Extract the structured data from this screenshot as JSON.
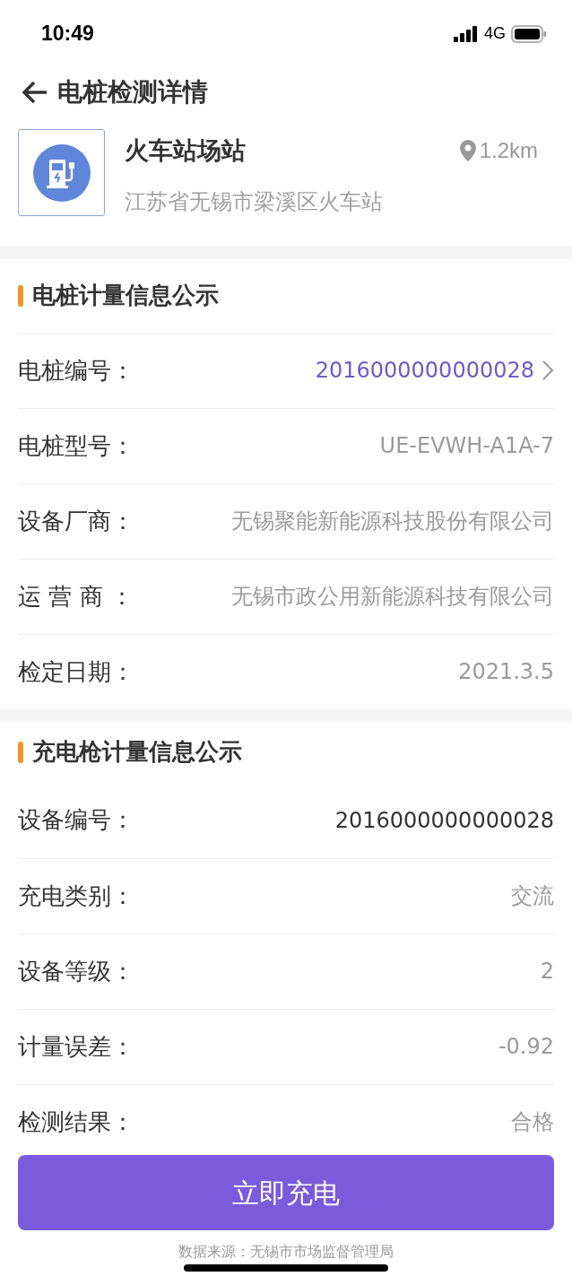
{
  "status_bar": {
    "time": "10:49",
    "network": "4G"
  },
  "header": {
    "title": "电桩检测详情"
  },
  "station": {
    "name": "火车站场站",
    "distance": "1.2km",
    "address": "江苏省无锡市梁溪区火车站"
  },
  "sections": [
    {
      "title": "电桩计量信息公示",
      "rows": [
        {
          "label": "电桩编号：",
          "value": "2016000000000028",
          "kind": "link"
        },
        {
          "label": "电桩型号：",
          "value": "UE-EVWH-A1A-7",
          "kind": "plain"
        },
        {
          "label": "设备厂商：",
          "value": "无锡聚能新能源科技股份有限公司",
          "kind": "plain"
        },
        {
          "label": "运 营 商 ：",
          "value": "无锡市政公用新能源科技有限公司",
          "kind": "plain"
        },
        {
          "label": "检定日期：",
          "value": "2021.3.5",
          "kind": "plain"
        }
      ]
    },
    {
      "title": "充电枪计量信息公示",
      "rows": [
        {
          "label": "设备编号：",
          "value": "2016000000000028",
          "kind": "strong"
        },
        {
          "label": "充电类别：",
          "value": "交流",
          "kind": "plain"
        },
        {
          "label": "设备等级：",
          "value": "2",
          "kind": "plain"
        },
        {
          "label": "计量误差：",
          "value": "-0.92",
          "kind": "plain"
        },
        {
          "label": "检测结果：",
          "value": "合格",
          "kind": "plain"
        }
      ]
    }
  ],
  "action_button": "立即充电",
  "footer": "数据来源：无锡市市场监督管理局"
}
